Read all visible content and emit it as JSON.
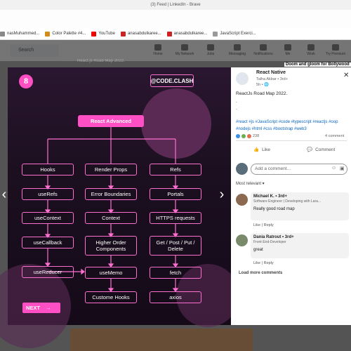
{
  "browser": {
    "title": "(3) Feed | LinkedIn - Brave",
    "bookmarks": [
      {
        "label": "nasMuhammed...",
        "color": "#888"
      },
      {
        "label": "Color Palette #4...",
        "color": "#d58c1a"
      },
      {
        "label": "YouTube",
        "color": "#e00"
      },
      {
        "label": "anasabdulkaree...",
        "color": "#c22"
      },
      {
        "label": "anasabdulkaree...",
        "color": "#c22"
      },
      {
        "label": "JavaScript Exerci...",
        "color": "#999"
      }
    ]
  },
  "linkedin_nav": {
    "search_placeholder": "Search",
    "items": [
      "Home",
      "My Network",
      "Jobs",
      "Messaging",
      "Notifications",
      "Me",
      "Work",
      "Try Premium"
    ],
    "feed_snippets": [
      "React.js Road Map 2022.",
      "Doom and gloom for Bollywood"
    ]
  },
  "diagram": {
    "slide_number": "8",
    "handle": "@CODE.CLASH",
    "root": "React Advanced",
    "columns": [
      {
        "nodes": [
          "Hooks",
          "useRefs",
          "useContext",
          "useCallback",
          "useReducer"
        ]
      },
      {
        "nodes": [
          "Render Props",
          "Error Boundaries",
          "Context",
          "Higher Order Components",
          "useMemo",
          "Custome Hooks"
        ]
      },
      {
        "nodes": [
          "Refs",
          "Portals",
          "HTTPS requests",
          "Get / Post / Put / Delete",
          "fetch",
          "axios"
        ]
      }
    ],
    "next_label": "NEXT",
    "next_arrow": "→"
  },
  "post": {
    "author": "React Native",
    "sub_author": "Talha Akbar • 3rd+",
    "time": "5h • 🌐",
    "body": "ReactJs Road Map 2022.",
    "dots": [
      ".",
      "."
    ],
    "hashtags": "#react #js #JavaScript #code #typescript #reactjs #oop #nodejs #html #css #bootstrap #web3",
    "reactions_count": "238",
    "comments_count": "4 comment",
    "like_label": "Like",
    "comment_label": "Comment",
    "add_comment_placeholder": "Add a comment…",
    "sort_label": "Most relevant ▾",
    "comments": [
      {
        "name": "Michael K. • 3rd+",
        "headline": "Software Engineer | Developing with Lara...",
        "text": "Really good road map",
        "like": "Like",
        "reply": "Reply"
      },
      {
        "name": "Dania Ratrout • 3rd+",
        "headline": "Front-End-Developer",
        "text": "great",
        "like": "Like",
        "reply": "Reply"
      }
    ],
    "load_more": "Load more comments"
  },
  "colors": {
    "accent": "#ff4fc4",
    "link": "#0a66c2"
  }
}
